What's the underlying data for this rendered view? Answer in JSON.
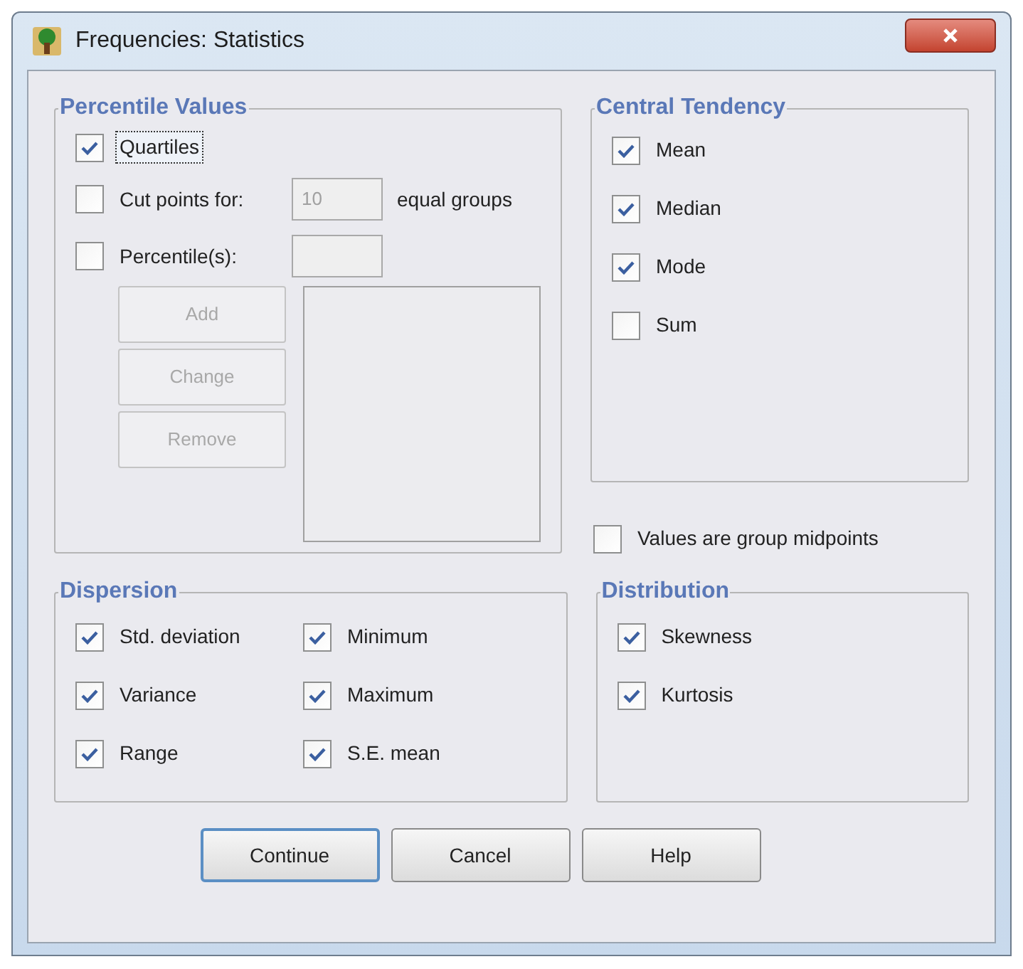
{
  "window": {
    "title": "Frequencies: Statistics"
  },
  "percentile_values": {
    "title": "Percentile Values",
    "options": [
      {
        "kind": "plain",
        "label": "Quartiles",
        "checked": true,
        "focused": true
      },
      {
        "kind": "count",
        "label": "Cut points for:",
        "checked": false,
        "focused": false,
        "value": "10",
        "suffix": "equal groups"
      },
      {
        "kind": "list",
        "label": "Percentile(s):",
        "checked": false,
        "focused": false
      }
    ],
    "buttons": [
      {
        "label": "Add",
        "disabled": true
      },
      {
        "label": "Change",
        "disabled": true
      },
      {
        "label": "Remove",
        "disabled": true
      }
    ]
  },
  "central_tendency": {
    "title": "Central Tendency",
    "items": [
      {
        "label": "Mean",
        "checked": true
      },
      {
        "label": "Median",
        "checked": true
      },
      {
        "label": "Mode",
        "checked": true
      },
      {
        "label": "Sum",
        "checked": false
      }
    ]
  },
  "group_midpoints": {
    "label": "Values are group midpoints",
    "checked": false
  },
  "dispersion": {
    "title": "Dispersion",
    "items": [
      {
        "label": "Std. deviation",
        "checked": true
      },
      {
        "label": "Minimum",
        "checked": true
      },
      {
        "label": "Variance",
        "checked": true
      },
      {
        "label": "Maximum",
        "checked": true
      },
      {
        "label": "Range",
        "checked": true
      },
      {
        "label": "S.E. mean",
        "checked": true
      }
    ]
  },
  "distribution": {
    "title": "Distribution",
    "items": [
      {
        "label": "Skewness",
        "checked": true
      },
      {
        "label": "Kurtosis",
        "checked": true
      }
    ]
  },
  "buttons": [
    {
      "label": "Continue",
      "default": true
    },
    {
      "label": "Cancel",
      "default": false
    },
    {
      "label": "Help",
      "default": false
    }
  ]
}
